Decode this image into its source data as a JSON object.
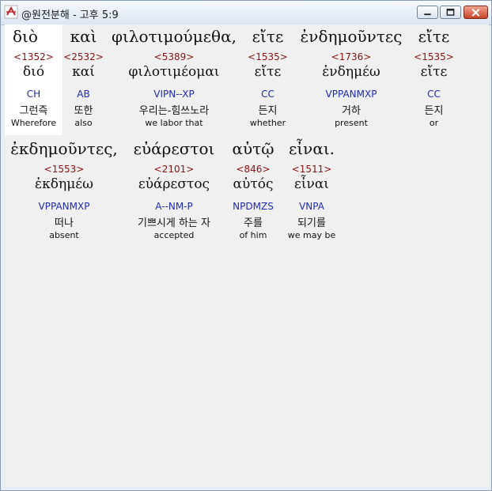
{
  "window": {
    "title": "@원전분해 - 고후 5:9"
  },
  "words": [
    {
      "greek": "διὸ",
      "strong": "<1352>",
      "lemma": "διό",
      "morph": "CH",
      "korean": "그런즉",
      "english": "Wherefore"
    },
    {
      "greek": "καὶ",
      "strong": "<2532>",
      "lemma": "καί",
      "morph": "AB",
      "korean": "또한",
      "english": "also"
    },
    {
      "greek": "φιλοτιμούμεθα,",
      "strong": "<5389>",
      "lemma": "φιλοτιμέομαι",
      "morph": "VIPN--XP",
      "korean": "우리는-힘쓰노라",
      "english": "we labor that"
    },
    {
      "greek": "εἴτε",
      "strong": "<1535>",
      "lemma": "εἴτε",
      "morph": "CC",
      "korean": "든지",
      "english": "whether"
    },
    {
      "greek": "ἐνδημοῦντες",
      "strong": "<1736>",
      "lemma": "ἐνδημέω",
      "morph": "VPPANMXP",
      "korean": "거하",
      "english": "present"
    },
    {
      "greek": "εἴτε",
      "strong": "<1535>",
      "lemma": "εἴτε",
      "morph": "CC",
      "korean": "든지",
      "english": "or"
    },
    {
      "greek": "ἐκδημοῦντες,",
      "strong": "<1553>",
      "lemma": "ἐκδημέω",
      "morph": "VPPANMXP",
      "korean": "떠나",
      "english": "absent"
    },
    {
      "greek": "εὐάρεστοι",
      "strong": "<2101>",
      "lemma": "εὐάρεστος",
      "morph": "A--NM-P",
      "korean": "기쁘시게 하는 자",
      "english": "accepted"
    },
    {
      "greek": "αὐτῷ",
      "strong": "<846>",
      "lemma": "αὐτός",
      "morph": "NPDMZS",
      "korean": "주를",
      "english": "of him"
    },
    {
      "greek": "εἶναι.",
      "strong": "<1511>",
      "lemma": "εἶναι",
      "morph": "VNPA",
      "korean": "되기를",
      "english": "we may be"
    }
  ]
}
